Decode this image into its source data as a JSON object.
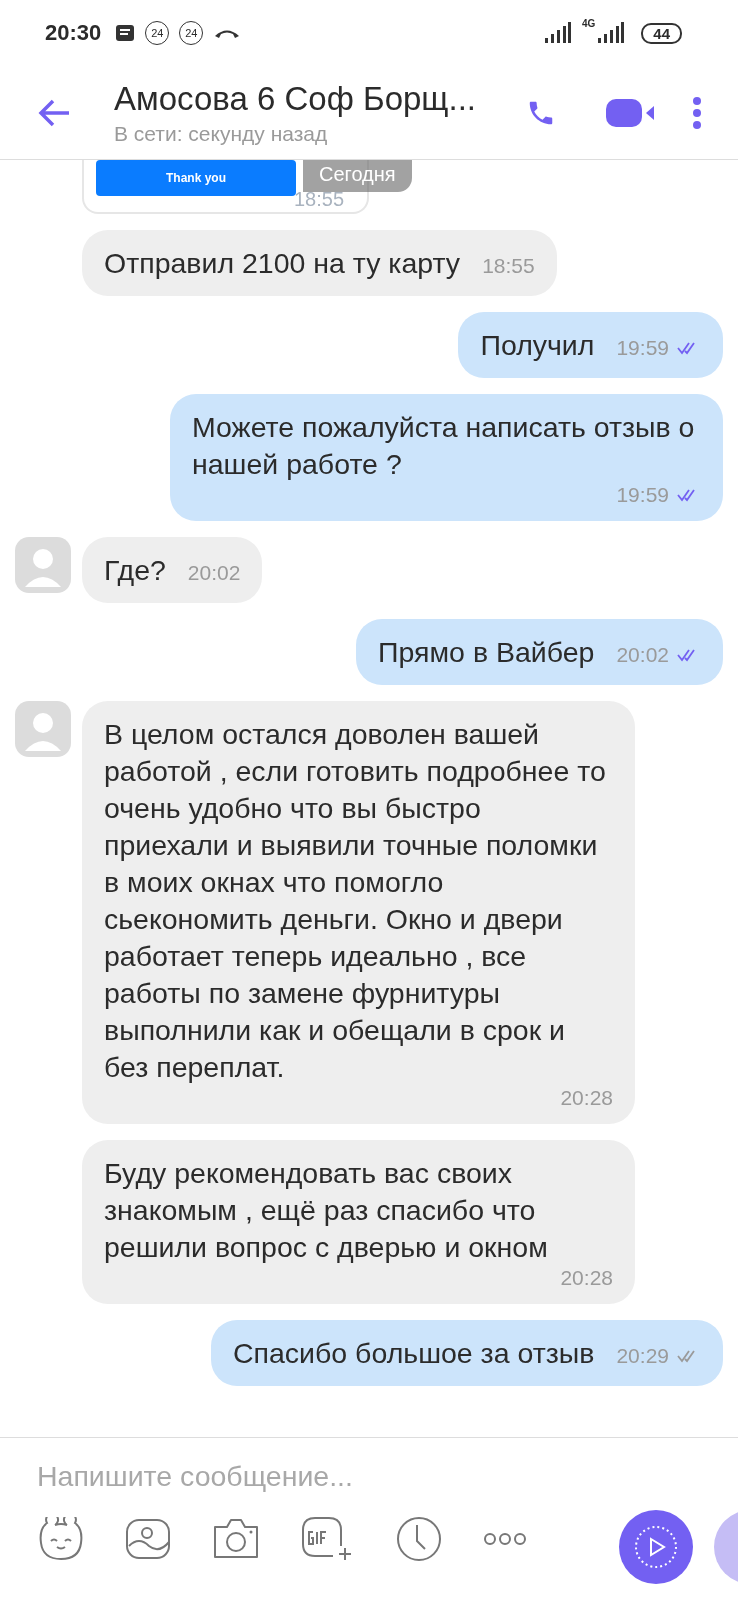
{
  "status_bar": {
    "time": "20:30",
    "badges": [
      "24",
      "24"
    ],
    "network": "4G",
    "battery": "44"
  },
  "header": {
    "title": "Амосова 6 Соф Борщ...",
    "subtitle": "В сети: секунду назад"
  },
  "preview": {
    "button": "Thank you",
    "date": "Сегодня",
    "time": "18:55"
  },
  "messages": [
    {
      "kind": "incoming",
      "avatar": false,
      "text": "Отправил 2100 на ту карту",
      "time": "18:55"
    },
    {
      "kind": "outgoing",
      "read": true,
      "text": "Получил",
      "time": "19:59"
    },
    {
      "kind": "outgoing",
      "read": true,
      "text": "Можете пожалуйста написать отзыв о нашей работе ?",
      "time": "19:59"
    },
    {
      "kind": "incoming",
      "avatar": true,
      "text": "Где?",
      "time": "20:02"
    },
    {
      "kind": "outgoing",
      "read": true,
      "text": "Прямо в Вайбер",
      "time": "20:02"
    },
    {
      "kind": "incoming",
      "avatar": true,
      "text": "В целом остался доволен вашей работой , если готовить подробнее то очень удобно что вы быстро приехали и выявили точные поломки в моих окнах что помогло сьекономить деньги. Окно и двери работает теперь идеально , все работы по замене фурнитуры выполнили как и обещали в срок и без переплат.",
      "time": "20:28"
    },
    {
      "kind": "incoming",
      "avatar": false,
      "text": "Буду рекомендовать вас своих знакомым , ещё раз спасибо что решили вопрос с дверью и окном",
      "time": "20:28"
    },
    {
      "kind": "outgoing",
      "read": false,
      "text": "Спасибо большое за отзыв",
      "time": "20:29"
    }
  ],
  "composer": {
    "placeholder": "Напишите сообщение..."
  }
}
